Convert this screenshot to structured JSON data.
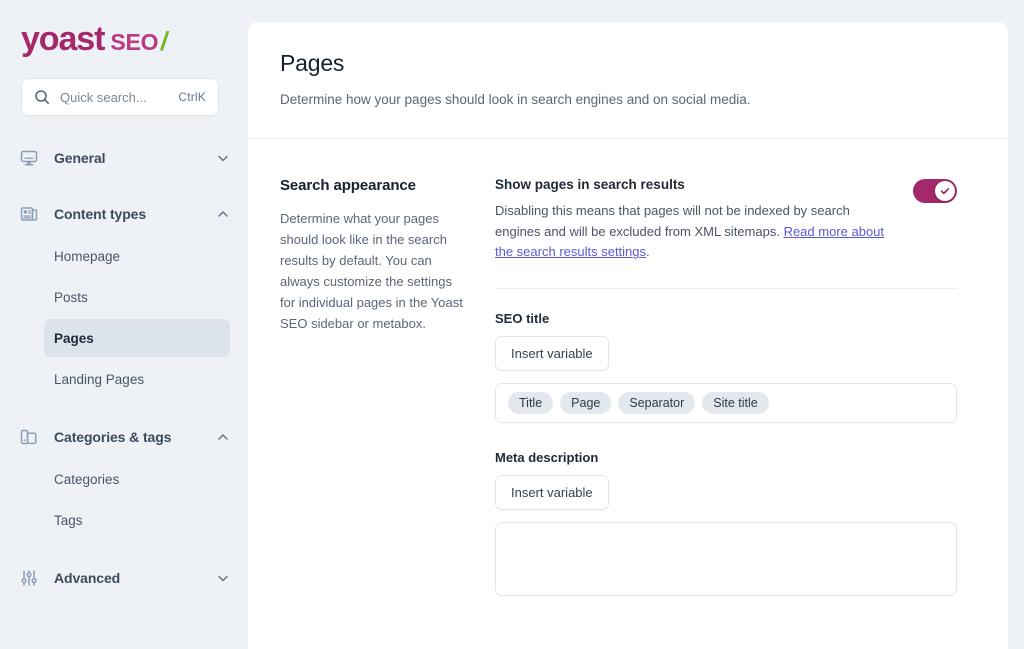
{
  "brand": {
    "name": "yoast",
    "product": "SEO",
    "slash": "/",
    "color_primary": "#a4286a",
    "color_secondary": "#bb3a82",
    "color_accent": "#77b227"
  },
  "search": {
    "placeholder": "Quick search...",
    "shortcut": "CtrlK",
    "value": ""
  },
  "sidebar": {
    "groups": [
      {
        "label": "General",
        "icon": "monitor-icon",
        "expanded": false,
        "chevron": "chevron-down-icon",
        "items": []
      },
      {
        "label": "Content types",
        "icon": "content-types-icon",
        "expanded": true,
        "chevron": "chevron-up-icon",
        "items": [
          {
            "label": "Homepage",
            "active": false
          },
          {
            "label": "Posts",
            "active": false
          },
          {
            "label": "Pages",
            "active": true
          },
          {
            "label": "Landing Pages",
            "active": false
          }
        ]
      },
      {
        "label": "Categories & tags",
        "icon": "tags-icon",
        "expanded": true,
        "chevron": "chevron-up-icon",
        "items": [
          {
            "label": "Categories",
            "active": false
          },
          {
            "label": "Tags",
            "active": false
          }
        ]
      },
      {
        "label": "Advanced",
        "icon": "sliders-icon",
        "expanded": false,
        "chevron": "chevron-down-icon",
        "items": []
      }
    ]
  },
  "header": {
    "title": "Pages",
    "description": "Determine how your pages should look in search engines and on social media."
  },
  "search_appearance": {
    "title": "Search appearance",
    "description": "Determine what your pages should look like in the search results by default. You can always customize the settings for individual pages in the Yoast SEO sidebar or metabox."
  },
  "show_in_search": {
    "label": "Show pages in search results",
    "description_before": "Disabling this means that pages will not be indexed by search engines and will be excluded from XML sitemaps. ",
    "link_text": "Read more about the search results settings",
    "description_after": ".",
    "enabled": true,
    "toggle_color": "#a4286a"
  },
  "seo_title": {
    "label": "SEO title",
    "insert_variable_label": "Insert variable",
    "variables": [
      "Title",
      "Page",
      "Separator",
      "Site title"
    ]
  },
  "meta_description": {
    "label": "Meta description",
    "insert_variable_label": "Insert variable",
    "value": "",
    "placeholder": ""
  }
}
